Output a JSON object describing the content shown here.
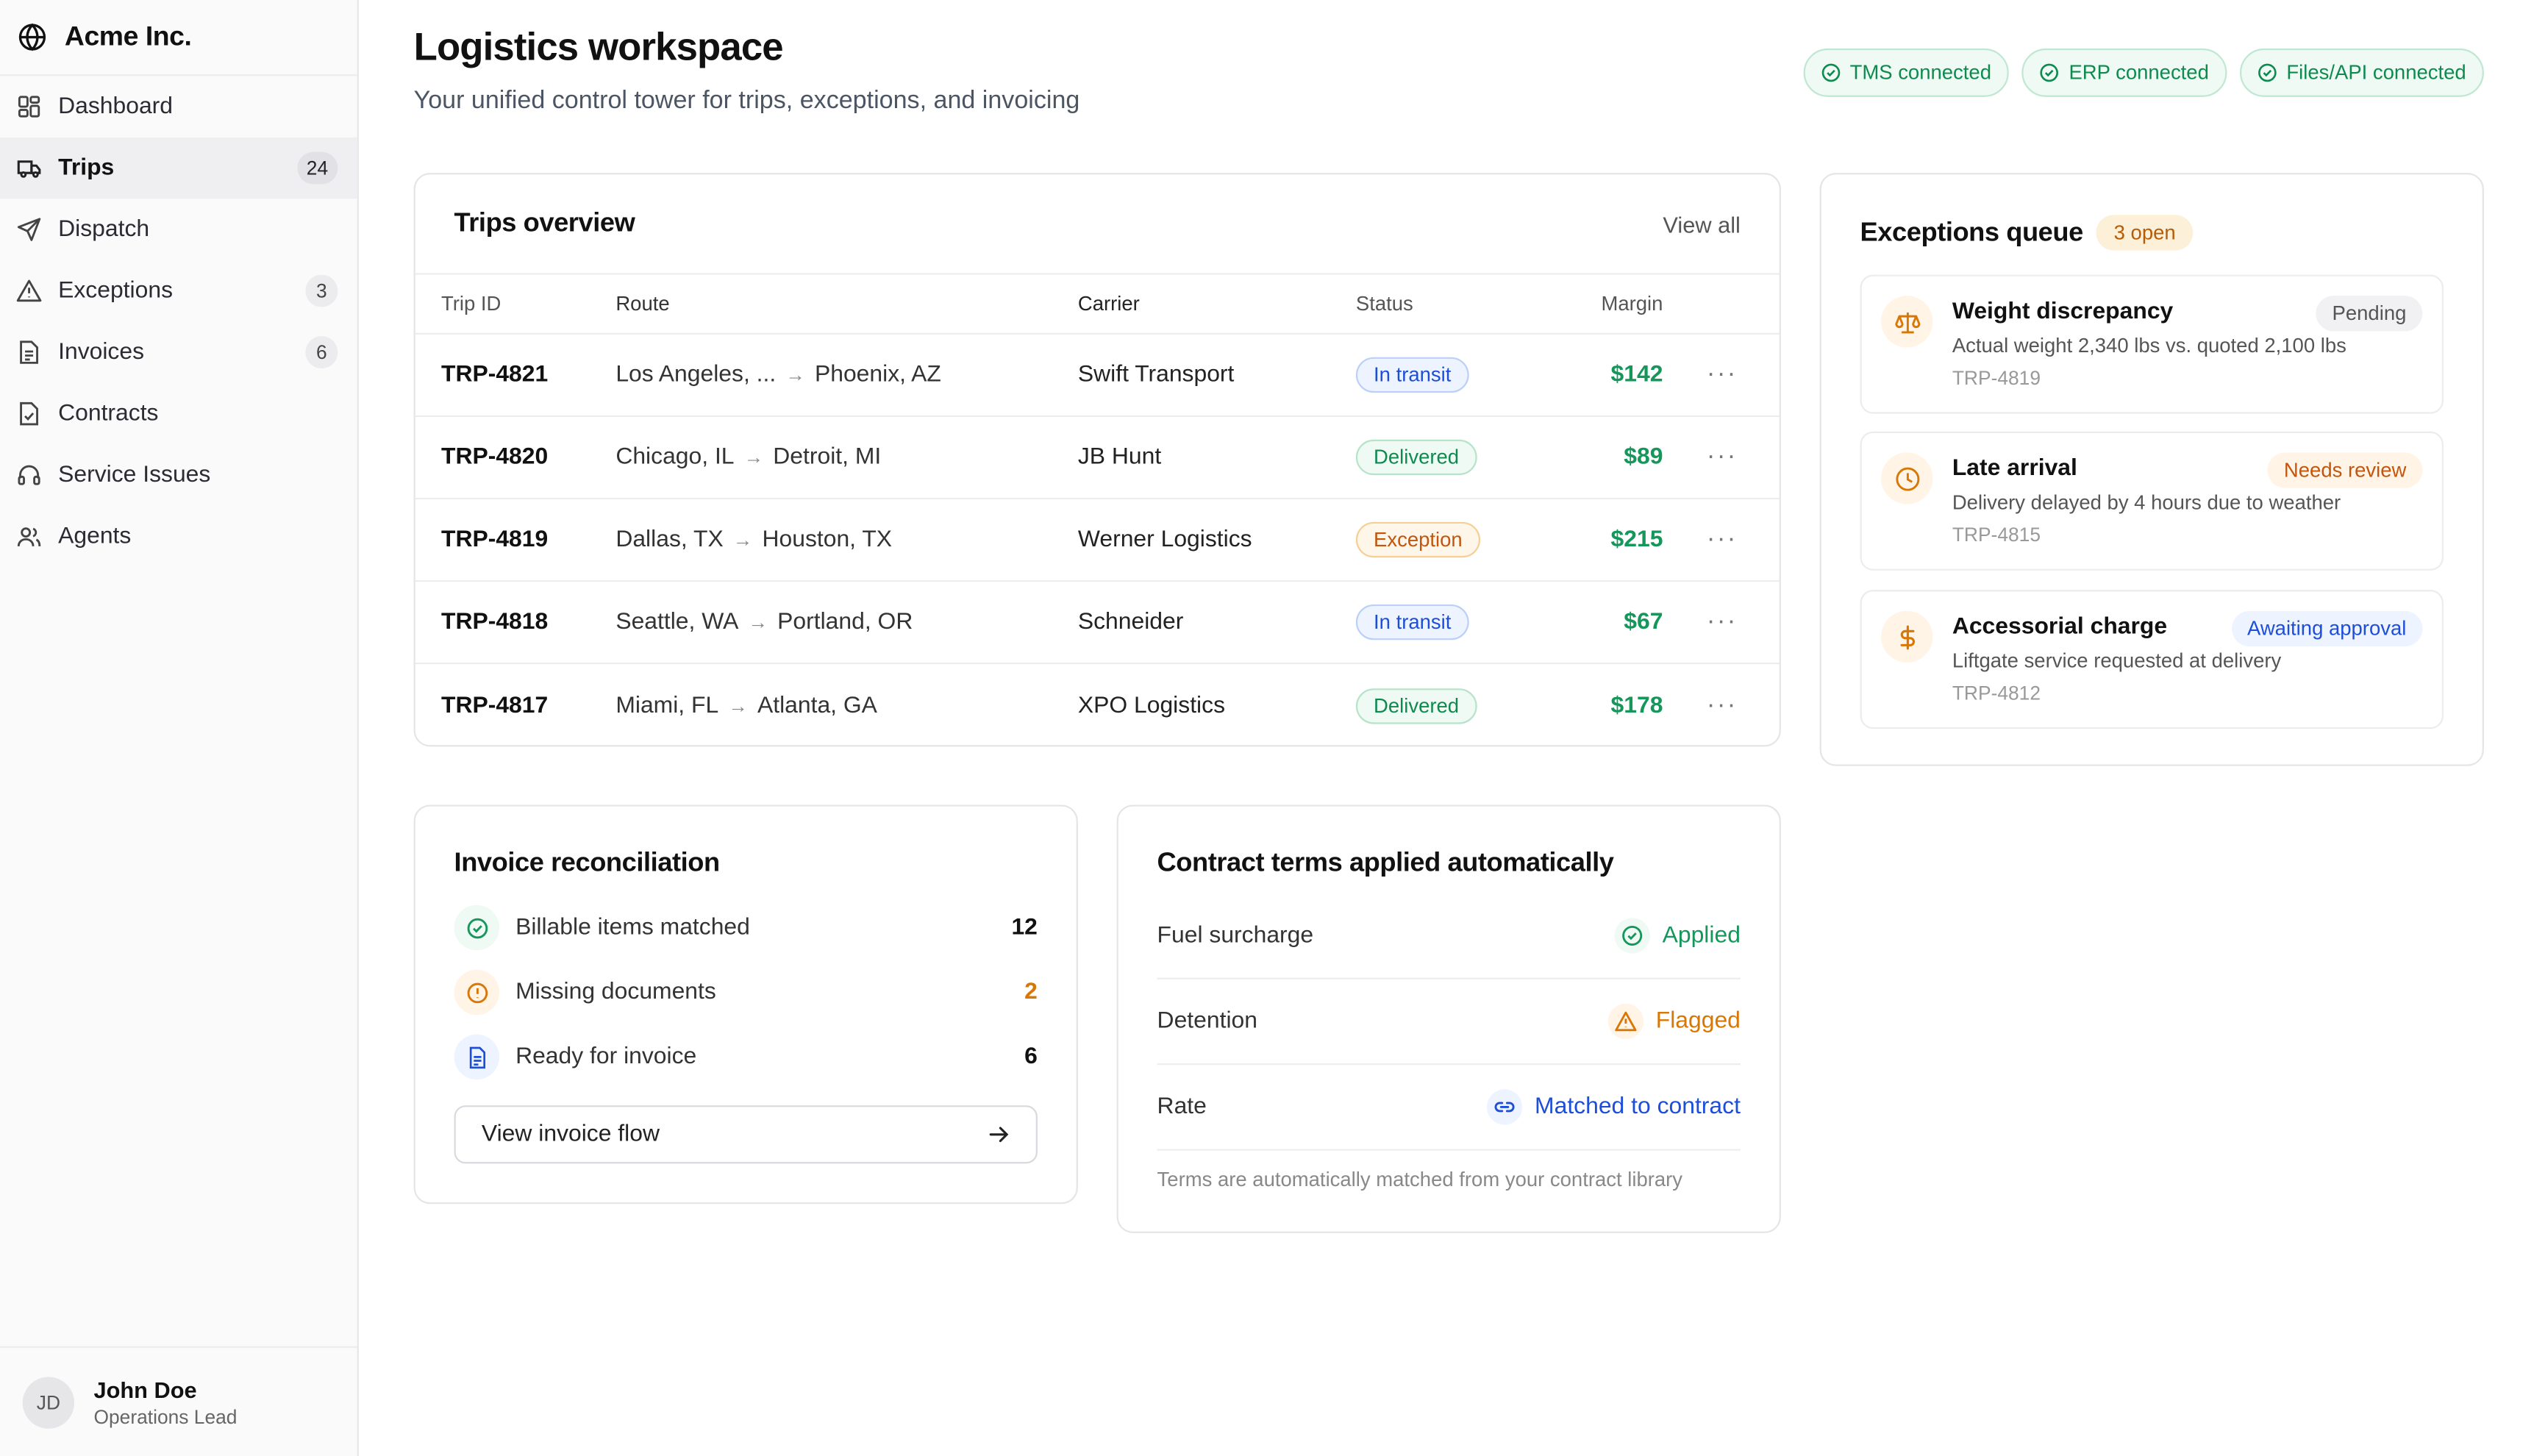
{
  "colors": {
    "accent_green": "#15965b",
    "accent_blue": "#1d4ed8",
    "accent_orange": "#c2560c"
  },
  "brand": {
    "name": "Acme Inc.",
    "icon": "globe-icon"
  },
  "sidebar": {
    "items": [
      {
        "label": "Dashboard",
        "icon": "dashboard-icon",
        "badge": ""
      },
      {
        "label": "Trips",
        "icon": "truck-icon",
        "badge": "24",
        "active": true
      },
      {
        "label": "Dispatch",
        "icon": "send-icon",
        "badge": ""
      },
      {
        "label": "Exceptions",
        "icon": "warning-icon",
        "badge": "3"
      },
      {
        "label": "Invoices",
        "icon": "document-icon",
        "badge": "6"
      },
      {
        "label": "Contracts",
        "icon": "contract-icon",
        "badge": ""
      },
      {
        "label": "Service Issues",
        "icon": "headset-icon",
        "badge": ""
      },
      {
        "label": "Agents",
        "icon": "users-icon",
        "badge": ""
      }
    ]
  },
  "user": {
    "initials": "JD",
    "name": "John Doe",
    "role": "Operations Lead"
  },
  "header": {
    "title": "Logistics workspace",
    "subtitle": "Your unified control tower for trips, exceptions, and invoicing",
    "connections": [
      "TMS connected",
      "ERP connected",
      "Files/API connected"
    ]
  },
  "trips": {
    "title": "Trips overview",
    "view_all": "View all",
    "columns": [
      "Trip ID",
      "Route",
      "Carrier",
      "Status",
      "Margin"
    ],
    "rows": [
      {
        "id": "TRP-4821",
        "from": "Los Angeles, ...",
        "to": "Phoenix, AZ",
        "carrier": "Swift Transport",
        "status": "In transit",
        "status_kind": "transit",
        "margin": "$142"
      },
      {
        "id": "TRP-4820",
        "from": "Chicago, IL",
        "to": "Detroit, MI",
        "carrier": "JB Hunt",
        "status": "Delivered",
        "status_kind": "delivered",
        "margin": "$89"
      },
      {
        "id": "TRP-4819",
        "from": "Dallas, TX",
        "to": "Houston, TX",
        "carrier": "Werner Logistics",
        "status": "Exception",
        "status_kind": "exception",
        "margin": "$215"
      },
      {
        "id": "TRP-4818",
        "from": "Seattle, WA",
        "to": "Portland, OR",
        "carrier": "Schneider",
        "status": "In transit",
        "status_kind": "transit",
        "margin": "$67"
      },
      {
        "id": "TRP-4817",
        "from": "Miami, FL",
        "to": "Atlanta, GA",
        "carrier": "XPO Logistics",
        "status": "Delivered",
        "status_kind": "delivered",
        "margin": "$178"
      }
    ]
  },
  "exceptions": {
    "title": "Exceptions queue",
    "open_badge": "3 open",
    "items": [
      {
        "title": "Weight discrepancy",
        "desc": "Actual weight 2,340 lbs vs. quoted 2,100 lbs",
        "ref": "TRP-4819",
        "tag": "Pending",
        "icon": "scale-icon"
      },
      {
        "title": "Late arrival",
        "desc": "Delivery delayed by 4 hours due to weather",
        "ref": "TRP-4815",
        "tag": "Needs review",
        "icon": "clock-icon"
      },
      {
        "title": "Accessorial charge",
        "desc": "Liftgate service requested at delivery",
        "ref": "TRP-4812",
        "tag": "Awaiting approval",
        "icon": "dollar-icon"
      }
    ]
  },
  "invoice": {
    "title": "Invoice reconciliation",
    "rows": [
      {
        "label": "Billable items matched",
        "value": "12",
        "icon": "check-circle-icon"
      },
      {
        "label": "Missing documents",
        "value": "2",
        "icon": "alert-circle-icon"
      },
      {
        "label": "Ready for invoice",
        "value": "6",
        "icon": "document-icon"
      }
    ],
    "button": "View invoice flow"
  },
  "contracts": {
    "title": "Contract terms applied automatically",
    "rows": [
      {
        "label": "Fuel surcharge",
        "value": "Applied",
        "icon": "check-circle-icon"
      },
      {
        "label": "Detention",
        "value": "Flagged",
        "icon": "warning-icon"
      },
      {
        "label": "Rate",
        "value": "Matched to contract",
        "icon": "link-icon"
      }
    ],
    "note": "Terms are automatically matched from your contract library"
  }
}
